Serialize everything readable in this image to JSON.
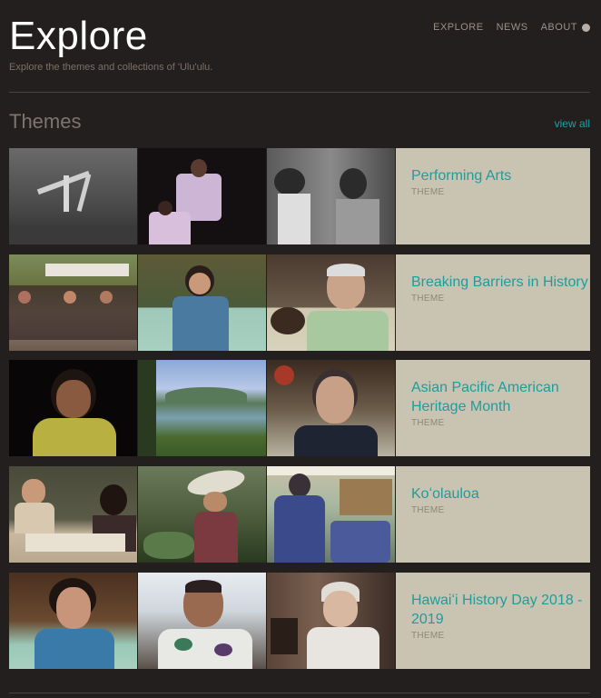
{
  "header": {
    "title": "Explore",
    "subtitle": "Explore the themes and collections of 'Ulu'ulu.",
    "nav": [
      {
        "label": "EXPLORE"
      },
      {
        "label": "NEWS"
      },
      {
        "label": "ABOUT"
      }
    ]
  },
  "section": {
    "title": "Themes",
    "view_all": "view all"
  },
  "themes": [
    {
      "title": "Performing Arts",
      "type": "THEME"
    },
    {
      "title": "Breaking Barriers in History",
      "type": "THEME"
    },
    {
      "title": "Asian Pacific American Heritage Month",
      "type": "THEME"
    },
    {
      "title": "Koʻolauloa",
      "type": "THEME"
    },
    {
      "title": "Hawaiʻi History Day 2018 - 2019",
      "type": "THEME"
    }
  ]
}
